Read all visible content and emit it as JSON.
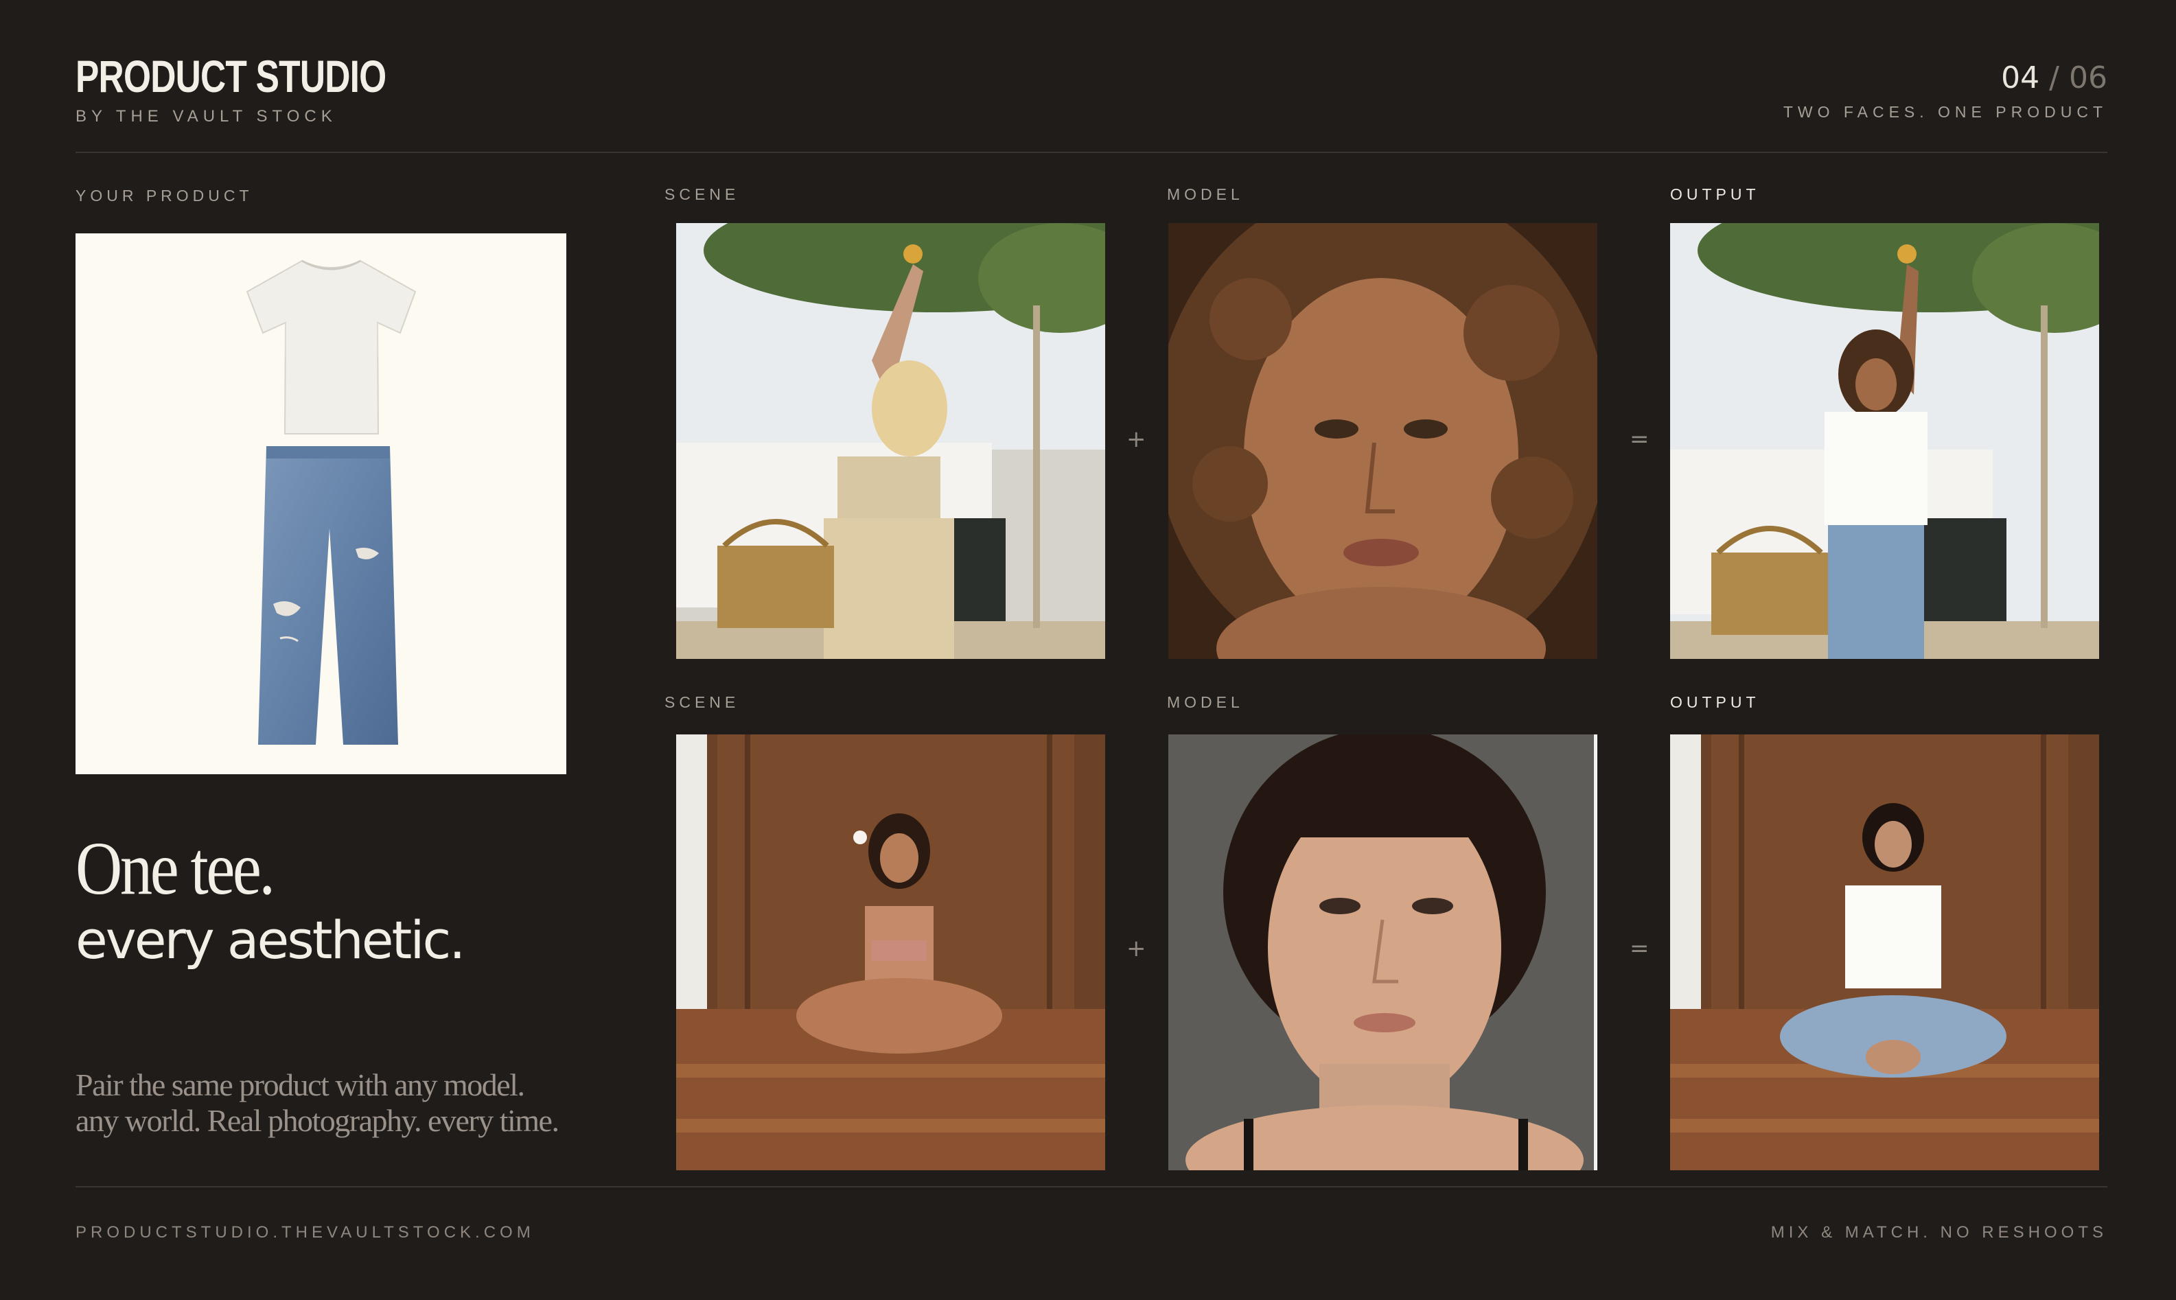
{
  "brand": {
    "title": "PRODUCT STUDIO",
    "subtitle": "BY THE VAULT STOCK"
  },
  "pager": {
    "current": "04",
    "separator": "/",
    "total": "06",
    "tagline": "TWO FACES. ONE PRODUCT"
  },
  "left": {
    "label": "YOUR PRODUCT",
    "headline_line1": "One tee.",
    "headline_line2": "every aesthetic.",
    "blurb": "Pair the same product with any model. any world. Real photography. every time."
  },
  "rows": [
    {
      "scene_label": "SCENE",
      "model_label": "MODEL",
      "output_label": "OUTPUT",
      "plus": "+",
      "equals": "="
    },
    {
      "scene_label": "SCENE",
      "model_label": "MODEL",
      "output_label": "OUTPUT",
      "plus": "+",
      "equals": "="
    }
  ],
  "footer": {
    "left": "PRODUCTSTUDIO.THEVAULTSTOCK.COM",
    "right": "MIX & MATCH. NO RESHOOTS"
  },
  "colors": {
    "background": "#201c1a",
    "card": "#fdfaf2",
    "text": "#f3eee6",
    "muted": "#a79f95",
    "rule": "#3a3532"
  },
  "icons": {
    "product": [
      "white-tshirt-icon",
      "ripped-jeans-icon"
    ]
  }
}
